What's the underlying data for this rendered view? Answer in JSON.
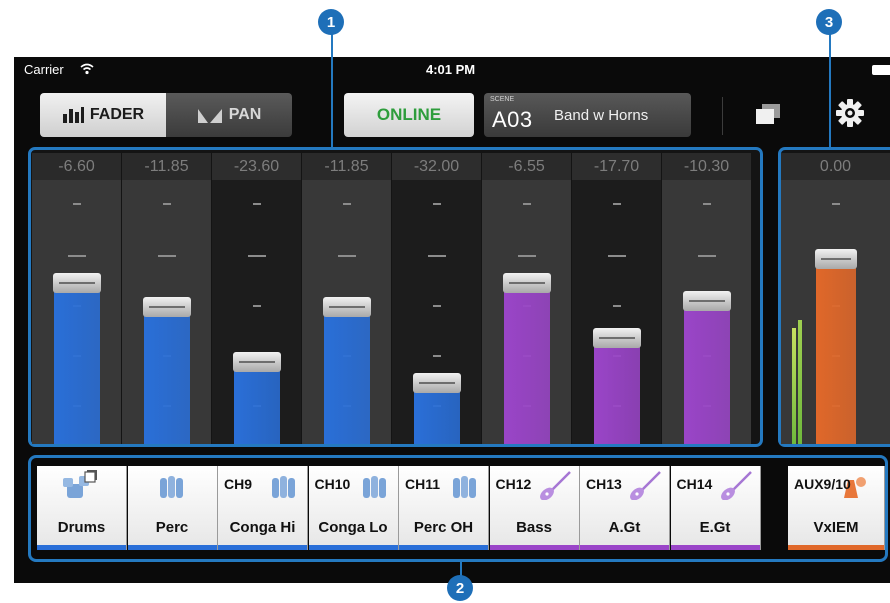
{
  "status_bar": {
    "carrier": "Carrier",
    "time": "4:01 PM"
  },
  "toolbar": {
    "fader_label": "FADER",
    "pan_label": "PAN",
    "online_label": "ONLINE",
    "scene_caption": "SCENE",
    "scene_number": "A03",
    "scene_name": "Band w Horns"
  },
  "channels": [
    {
      "value": "-6.60",
      "num": "",
      "name": "Drums",
      "fader_level": 0.61,
      "color": "#2a6fd8",
      "strip": "gray",
      "icon": "drum-kit-icon"
    },
    {
      "value": "-11.85",
      "num": "",
      "name": "Perc",
      "fader_level": 0.52,
      "color": "#2a6fd8",
      "strip": "gray",
      "icon": "congas-icon"
    },
    {
      "value": "-23.60",
      "num": "CH9",
      "name": "Conga Hi",
      "fader_level": 0.31,
      "color": "#2a6fd8",
      "strip": "dark",
      "icon": "congas-icon"
    },
    {
      "value": "-11.85",
      "num": "CH10",
      "name": "Conga Lo",
      "fader_level": 0.52,
      "color": "#2a6fd8",
      "strip": "gray",
      "icon": "congas-icon"
    },
    {
      "value": "-32.00",
      "num": "CH11",
      "name": "Perc OH",
      "fader_level": 0.23,
      "color": "#2a6fd8",
      "strip": "dark",
      "icon": "congas-icon"
    },
    {
      "value": "-6.55",
      "num": "CH12",
      "name": "Bass",
      "fader_level": 0.61,
      "color": "#9a45c8",
      "strip": "gray",
      "icon": "guitar-icon"
    },
    {
      "value": "-17.70",
      "num": "CH13",
      "name": "A.Gt",
      "fader_level": 0.4,
      "color": "#9a45c8",
      "strip": "dark",
      "icon": "guitar-icon"
    },
    {
      "value": "-10.30",
      "num": "CH14",
      "name": "E.Gt",
      "fader_level": 0.54,
      "color": "#9a45c8",
      "strip": "gray",
      "icon": "guitar-icon"
    }
  ],
  "aux": {
    "value": "0.00",
    "num": "AUX9/10",
    "name": "VxIEM",
    "fader_level": 0.7,
    "color": "#e0682a",
    "icon": "in-ear-monitor-icon"
  },
  "callouts": [
    "1",
    "2",
    "3"
  ]
}
